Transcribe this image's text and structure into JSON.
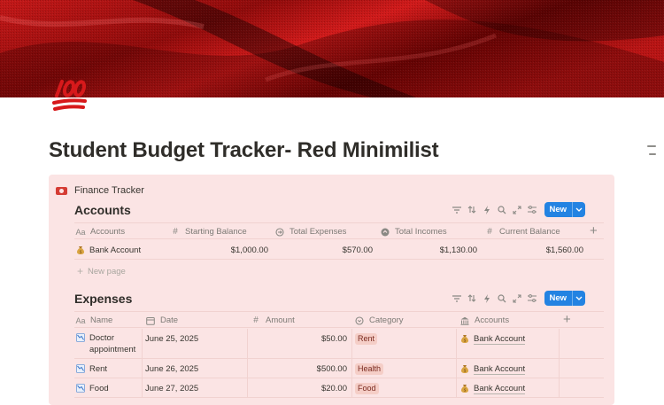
{
  "page": {
    "title": "Student Budget Tracker- Red Minimilist",
    "icon": "hundred-points-icon"
  },
  "callout": {
    "title": "Finance Tracker",
    "icon": "money-icon"
  },
  "colors": {
    "callout_bg": "#fbe4e4",
    "new_button": "#2383e2",
    "tag_rent": "#f5cec7",
    "tag_health": "#f5cec7",
    "tag_food": "#f5cec7",
    "cover": "#b30f0f"
  },
  "toolbar": {
    "icons": [
      "filter-icon",
      "sort-icon",
      "automation-icon",
      "search-icon",
      "expand-icon",
      "settings-icon"
    ],
    "new_label": "New"
  },
  "accounts": {
    "title": "Accounts",
    "columns": [
      "Accounts",
      "Starting Balance",
      "Total Expenses",
      "Total Incomes",
      "Current Balance"
    ],
    "rows": [
      {
        "name": "Bank Account",
        "starting": "$1,000.00",
        "expenses": "$570.00",
        "incomes": "$1,130.00",
        "current": "$1,560.00"
      }
    ],
    "new_page": "New page"
  },
  "expenses": {
    "title": "Expenses",
    "columns": [
      "Name",
      "Date",
      "Amount",
      "Category",
      "Accounts"
    ],
    "rows": [
      {
        "name": "Doctor appointment",
        "name_line1": "Doctor",
        "name_line2": "appointment",
        "date": "June 25, 2025",
        "amount": "$50.00",
        "category": "Rent",
        "account": "Bank Account"
      },
      {
        "name": "Rent",
        "date": "June 26, 2025",
        "amount": "$500.00",
        "category": "Health",
        "account": "Bank Account"
      },
      {
        "name": "Food",
        "date": "June 27, 2025",
        "amount": "$20.00",
        "category": "Food",
        "account": "Bank Account"
      }
    ]
  }
}
